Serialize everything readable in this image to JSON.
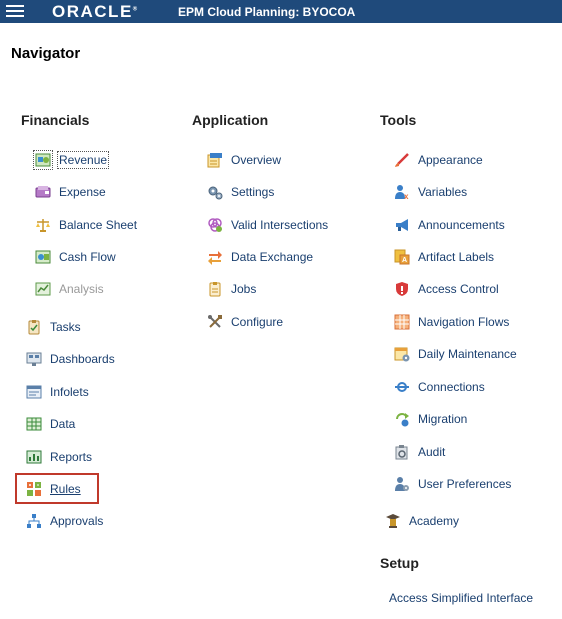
{
  "header": {
    "logo": "ORACLE",
    "app_title": "EPM Cloud Planning: BYOCOA"
  },
  "page_title": "Navigator",
  "financials": {
    "heading": "Financials",
    "items": [
      {
        "label": "Revenue",
        "icon": "revenue-icon"
      },
      {
        "label": "Expense",
        "icon": "expense-icon"
      },
      {
        "label": "Balance Sheet",
        "icon": "balance-scale-icon"
      },
      {
        "label": "Cash Flow",
        "icon": "cash-flow-icon"
      },
      {
        "label": "Analysis",
        "icon": "analysis-icon",
        "disabled": true
      }
    ]
  },
  "main_links": [
    {
      "label": "Tasks",
      "icon": "tasks-icon"
    },
    {
      "label": "Dashboards",
      "icon": "dashboards-icon"
    },
    {
      "label": "Infolets",
      "icon": "infolets-icon"
    },
    {
      "label": "Data",
      "icon": "data-grid-icon"
    },
    {
      "label": "Reports",
      "icon": "reports-icon"
    },
    {
      "label": "Rules",
      "icon": "rules-icon",
      "highlighted": true
    },
    {
      "label": "Approvals",
      "icon": "approvals-icon"
    }
  ],
  "application": {
    "heading": "Application",
    "items": [
      {
        "label": "Overview",
        "icon": "overview-icon"
      },
      {
        "label": "Settings",
        "icon": "settings-gear-icon"
      },
      {
        "label": "Valid Intersections",
        "icon": "valid-intersections-icon"
      },
      {
        "label": "Data Exchange",
        "icon": "data-exchange-icon"
      },
      {
        "label": "Jobs",
        "icon": "jobs-icon"
      },
      {
        "label": "Configure",
        "icon": "configure-tools-icon"
      }
    ]
  },
  "tools": {
    "heading": "Tools",
    "items": [
      {
        "label": "Appearance",
        "icon": "appearance-brush-icon"
      },
      {
        "label": "Variables",
        "icon": "variables-icon"
      },
      {
        "label": "Announcements",
        "icon": "announcements-megaphone-icon"
      },
      {
        "label": "Artifact Labels",
        "icon": "artifact-labels-icon"
      },
      {
        "label": "Access Control",
        "icon": "access-control-shield-icon"
      },
      {
        "label": "Navigation Flows",
        "icon": "navigation-flows-icon"
      },
      {
        "label": "Daily Maintenance",
        "icon": "daily-maintenance-icon"
      },
      {
        "label": "Connections",
        "icon": "connections-icon"
      },
      {
        "label": "Migration",
        "icon": "migration-icon"
      },
      {
        "label": "Audit",
        "icon": "audit-icon"
      },
      {
        "label": "User Preferences",
        "icon": "user-preferences-icon"
      }
    ]
  },
  "academy": {
    "label": "Academy",
    "icon": "academy-icon"
  },
  "setup": {
    "heading": "Setup",
    "link": "Access Simplified Interface"
  }
}
